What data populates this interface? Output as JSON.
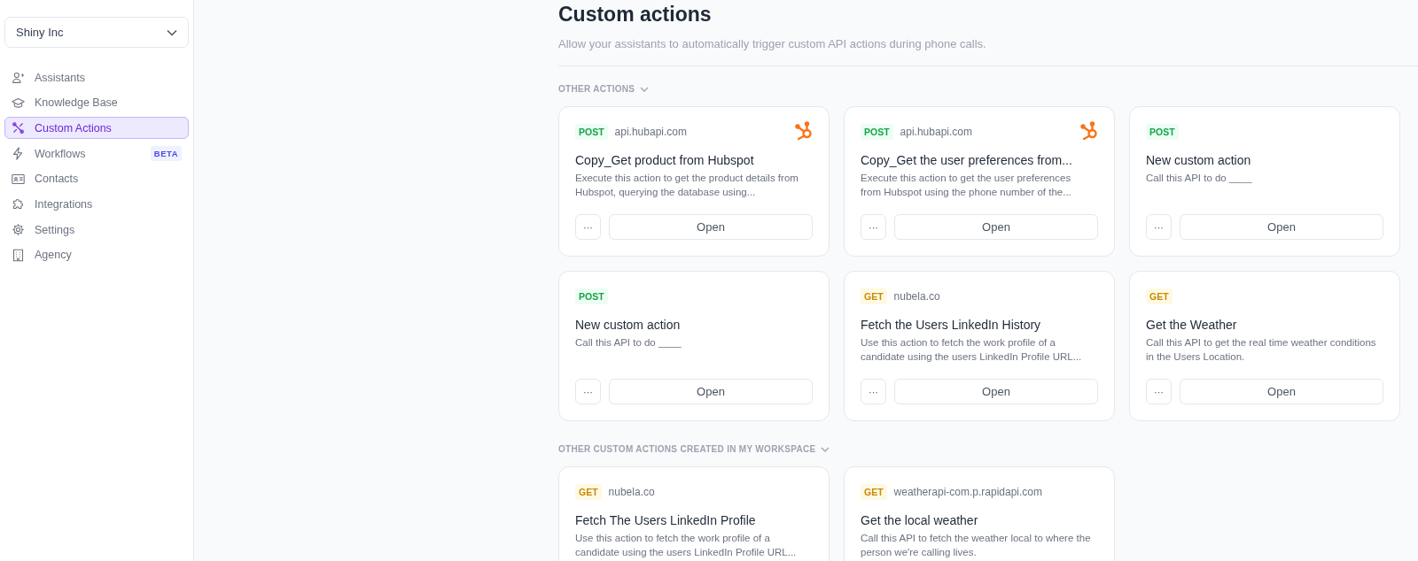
{
  "sidebar": {
    "workspace": "Shiny Inc",
    "items": [
      {
        "label": "Assistants",
        "selected": false
      },
      {
        "label": "Knowledge Base",
        "selected": false
      },
      {
        "label": "Custom Actions",
        "selected": true
      },
      {
        "label": "Workflows",
        "selected": false,
        "badge": "BETA"
      },
      {
        "label": "Contacts",
        "selected": false
      },
      {
        "label": "Integrations",
        "selected": false
      },
      {
        "label": "Settings",
        "selected": false
      },
      {
        "label": "Agency",
        "selected": false
      }
    ]
  },
  "header": {
    "title": "Custom actions",
    "subtitle": "Allow your assistants to automatically trigger custom API actions during phone calls."
  },
  "sections": [
    {
      "title": "OTHER ACTIONS",
      "expanded": true,
      "cards": [
        {
          "method": "POST",
          "host": "api.hubapi.com",
          "integration_logo": true,
          "title": "Copy_Get product from Hubspot",
          "description": "Execute this action to get the product details from Hubspot, querying the database using...",
          "more": "···",
          "open": "Open"
        },
        {
          "method": "POST",
          "host": "api.hubapi.com",
          "integration_logo": true,
          "title": "Copy_Get the user preferences from...",
          "description": "Execute this action to get the user preferences from Hubspot using the phone number of the...",
          "more": "···",
          "open": "Open"
        },
        {
          "method": "POST",
          "integration_logo": false,
          "title": "New custom action",
          "description": "Call this API to do ____",
          "more": "···",
          "open": "Open"
        },
        {
          "method": "POST",
          "integration_logo": false,
          "title": "New custom action",
          "description": "Call this API to do ____",
          "more": "···",
          "open": "Open"
        },
        {
          "method": "GET",
          "host": "nubela.co",
          "integration_logo": false,
          "title": "Fetch the Users LinkedIn History",
          "description": "Use this action to fetch the work profile of a candidate using the users LinkedIn Profile URL...",
          "more": "···",
          "open": "Open"
        },
        {
          "method": "GET",
          "integration_logo": false,
          "title": "Get the Weather",
          "description": "Call this API to get the real time weather conditions in the Users Location.",
          "more": "···",
          "open": "Open"
        }
      ]
    },
    {
      "title": "OTHER CUSTOM ACTIONS CREATED IN MY WORKSPACE",
      "expanded": true,
      "cards": [
        {
          "method": "GET",
          "host": "nubela.co",
          "integration_logo": false,
          "title": "Fetch The Users LinkedIn Profile",
          "description": "Use this action to fetch the work profile of a candidate using the users LinkedIn Profile URL..."
        },
        {
          "method": "GET",
          "host": "weatherapi-com.p.rapidapi.com",
          "integration_logo": false,
          "title": "Get the local weather",
          "description": "Call this API to fetch the weather local to where the person we're calling lives."
        }
      ]
    }
  ]
}
